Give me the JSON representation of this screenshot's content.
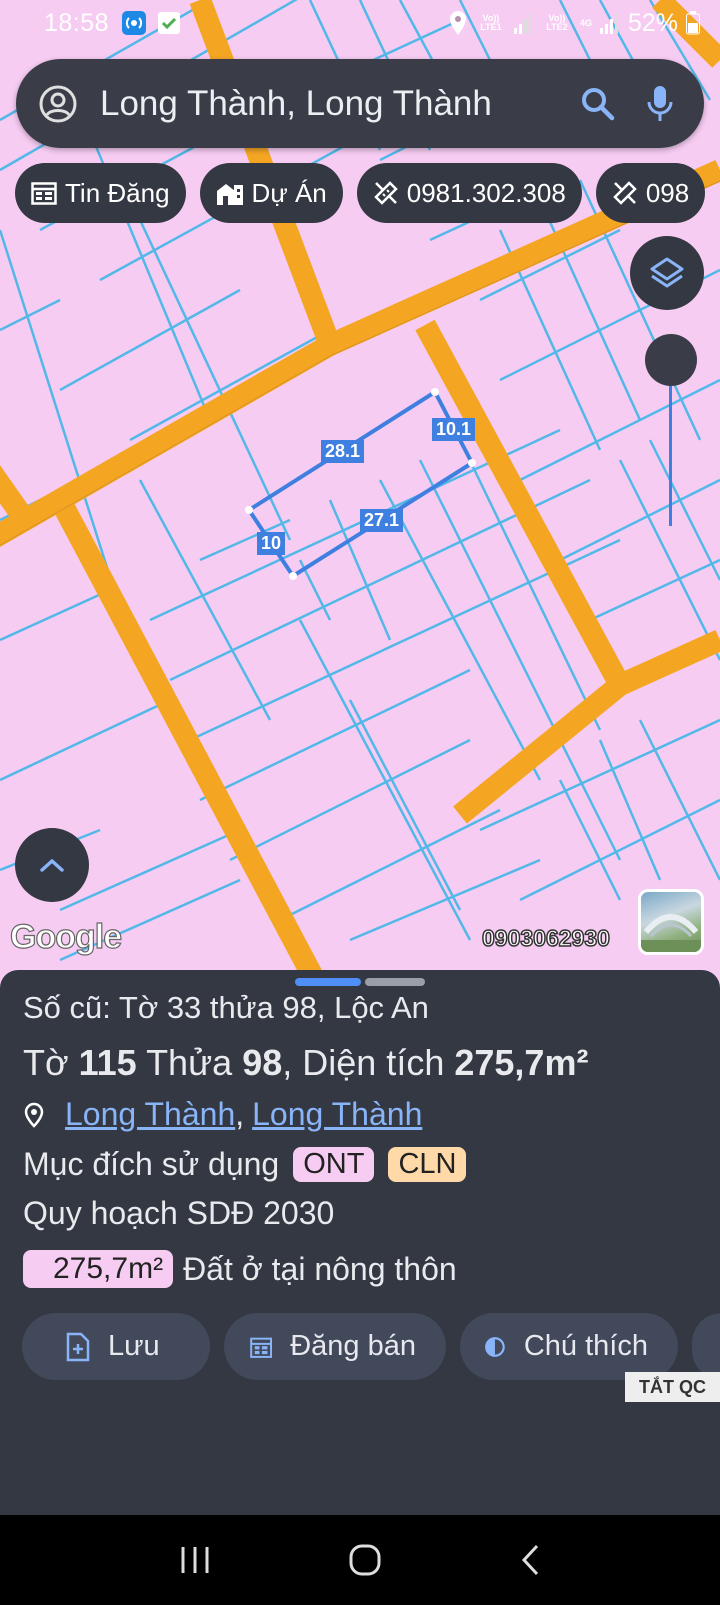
{
  "status_bar": {
    "time": "18:58",
    "lte1": "Vo)) LTE1",
    "lte2": "Vo)) LTE2",
    "net": "4G",
    "battery": "52%"
  },
  "search": {
    "text": "Long Thành, Long Thành"
  },
  "chips": [
    {
      "label": "Tin Đăng",
      "icon": "calendar-icon"
    },
    {
      "label": "Dự Án",
      "icon": "building-icon"
    },
    {
      "label": "0981.302.308",
      "icon": "ruler-icon"
    },
    {
      "label": "098",
      "icon": "ruler-icon"
    }
  ],
  "map": {
    "parcel_edges": [
      "28.1",
      "10.1",
      "27.1",
      "10"
    ],
    "google_label": "Google",
    "watermark_phone": "0903062930"
  },
  "panel": {
    "old_number": "Số cũ: Tờ 33 thửa 98, Lộc An",
    "to_label": "Tờ",
    "to_value": "115",
    "thua_label": "Thửa",
    "thua_value": "98",
    "dientich_label": ", Diện tích",
    "dientich_value": "275,7m²",
    "location_1": "Long Thành",
    "location_sep": ",",
    "location_2": "Long Thành",
    "purpose_label": "Mục đích sử dụng",
    "purpose_badges": [
      {
        "code": "ONT",
        "color": "#f7ccf3"
      },
      {
        "code": "CLN",
        "color": "#ffd9a8"
      }
    ],
    "planning_label": "Quy hoạch SDĐ 2030",
    "area_value": "275,7m²",
    "area_desc": "Đất ở tại nông thôn"
  },
  "actions": [
    {
      "label": "Lưu",
      "icon": "save-file-icon"
    },
    {
      "label": "Đăng bán",
      "icon": "calendar-icon"
    },
    {
      "label": "Chú thích",
      "icon": "contrast-icon"
    }
  ],
  "ad_toggle": "TẮT QC",
  "colors": {
    "land": "#f7ccf3",
    "road": "#f4a623",
    "lot_line": "#52b8e8",
    "parcel": "#3f7fe0",
    "panel_bg": "#343842"
  }
}
